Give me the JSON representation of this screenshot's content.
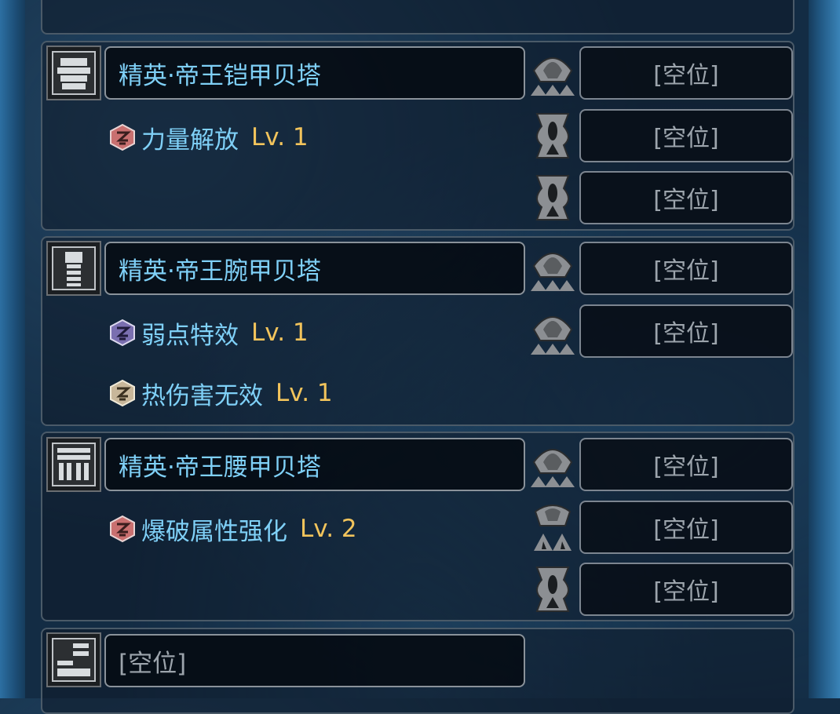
{
  "empty_label": "[空位]",
  "armor": [
    {
      "name": "精英·帝王铠甲贝塔",
      "piece_icon": "chest-armor-icon",
      "decoration_slots": [
        {
          "icon": "level-3-slot-icon",
          "label": "[空位]"
        },
        {
          "icon": "level-1-slot-icon",
          "label": "[空位]"
        },
        {
          "icon": "level-1-slot-icon",
          "label": "[空位]"
        }
      ],
      "skills": [
        {
          "name": "力量解放",
          "level": "Lv. 1",
          "gem_color": "#c97070"
        }
      ]
    },
    {
      "name": "精英·帝王腕甲贝塔",
      "piece_icon": "arm-armor-icon",
      "decoration_slots": [
        {
          "icon": "level-3-slot-icon",
          "label": "[空位]"
        },
        {
          "icon": "level-3-slot-icon",
          "label": "[空位]"
        }
      ],
      "skills": [
        {
          "name": "弱点特效",
          "level": "Lv. 1",
          "gem_color": "#7a6fb0"
        },
        {
          "name": "热伤害无效",
          "level": "Lv. 1",
          "gem_color": "#c8b79a"
        }
      ]
    },
    {
      "name": "精英·帝王腰甲贝塔",
      "piece_icon": "waist-armor-icon",
      "decoration_slots": [
        {
          "icon": "level-3-slot-icon",
          "label": "[空位]"
        },
        {
          "icon": "level-2-slot-icon",
          "label": "[空位]"
        },
        {
          "icon": "level-1-slot-icon",
          "label": "[空位]"
        }
      ],
      "skills": [
        {
          "name": "爆破属性强化",
          "level": "Lv. 2",
          "gem_color": "#c97070"
        }
      ]
    },
    {
      "name": "[空位]",
      "piece_icon": "leg-armor-icon"
    }
  ]
}
